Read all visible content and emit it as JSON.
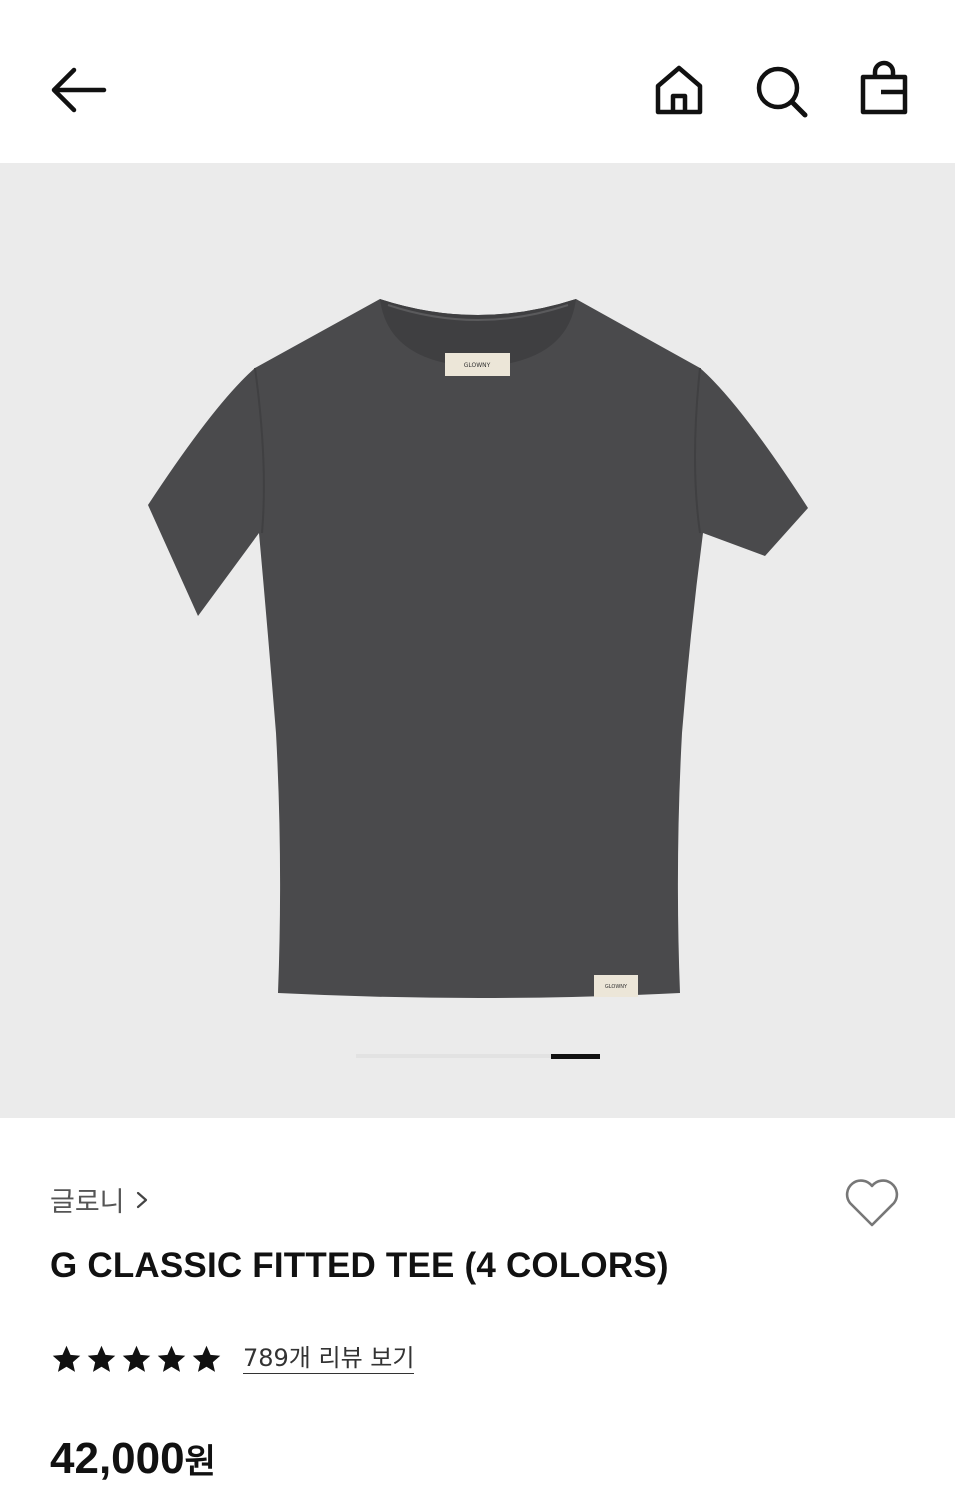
{
  "header": {
    "back_icon": "arrow-left-icon",
    "home_icon": "home-icon",
    "search_icon": "search-icon",
    "bag_icon": "shopping-bag-icon"
  },
  "gallery": {
    "background_color": "#ebebeb",
    "product_color": "#4a4a4c",
    "label_text": "GLOWNY",
    "image_count": 2,
    "active_image": 2
  },
  "product": {
    "brand": "글로니",
    "title": "G CLASSIC FITTED TEE (4 COLORS)",
    "rating": 5,
    "rating_max": 5,
    "review_link": "789개 리뷰 보기",
    "price": "42,000",
    "currency": "원"
  },
  "colors": {
    "text": "#111111",
    "brand_text": "#555555"
  }
}
